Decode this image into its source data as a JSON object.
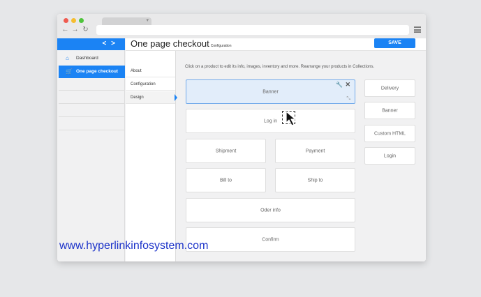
{
  "app": {
    "page_title": "One page checkout",
    "page_subtitle": "Configuration",
    "save_label": "SAVE",
    "hint": "Click on a product to edit its info, images, inventory and more. Rearrange your products in Collections."
  },
  "sidebar": {
    "collapse_arrows": "< >",
    "items": [
      {
        "label": "Dashboard",
        "icon": "home-icon"
      },
      {
        "label": "One page checkout",
        "icon": "cart-icon"
      }
    ]
  },
  "subnav": {
    "items": [
      {
        "label": "About"
      },
      {
        "label": "Configuration"
      },
      {
        "label": "Design"
      }
    ]
  },
  "layout_blocks": {
    "banner": "Banner",
    "login": "Log in",
    "shipment": "Shipment",
    "payment": "Payment",
    "bill_to": "Bill to",
    "ship_to": "Ship to",
    "order_info": "Oder info",
    "confirm": "Confirm"
  },
  "palette": {
    "delivery": "Delivery",
    "banner": "Banner",
    "custom_html": "Custom HTML",
    "login": "Login"
  },
  "watermark": "www.hyperlinkinfosystem.com",
  "colors": {
    "accent": "#1b83f4",
    "selected_block": "#e2edfa",
    "watermark": "#1c33c9"
  }
}
